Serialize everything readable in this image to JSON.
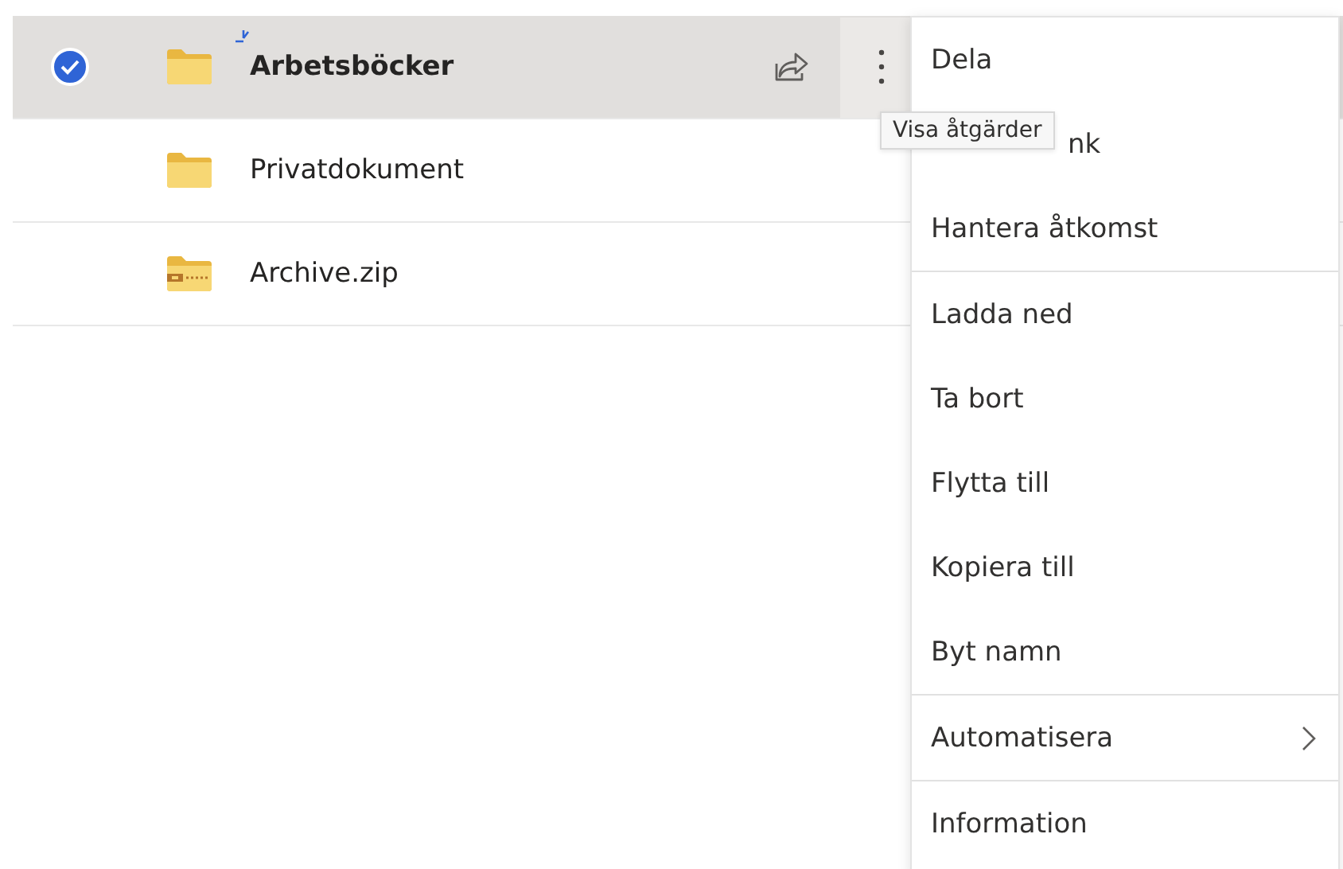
{
  "files": [
    {
      "name": "Arbetsböcker",
      "kind": "folder",
      "selected": true,
      "new_indicator": true
    },
    {
      "name": "Privatdokument",
      "kind": "folder",
      "selected": false,
      "new_indicator": false
    },
    {
      "name": "Archive.zip",
      "kind": "zip",
      "selected": false,
      "new_indicator": false
    }
  ],
  "tooltip": "Visa åtgärder",
  "menu": {
    "groups": [
      [
        {
          "label": "Dela",
          "submenu": false
        },
        {
          "label": "nk",
          "submenu": false,
          "covered": true
        },
        {
          "label": "Hantera åtkomst",
          "submenu": false
        }
      ],
      [
        {
          "label": "Ladda ned",
          "submenu": false
        },
        {
          "label": "Ta bort",
          "submenu": false
        },
        {
          "label": "Flytta till",
          "submenu": false
        },
        {
          "label": "Kopiera till",
          "submenu": false
        },
        {
          "label": "Byt namn",
          "submenu": false
        }
      ],
      [
        {
          "label": "Automatisera",
          "submenu": true
        }
      ],
      [
        {
          "label": "Information",
          "submenu": false
        }
      ]
    ]
  }
}
